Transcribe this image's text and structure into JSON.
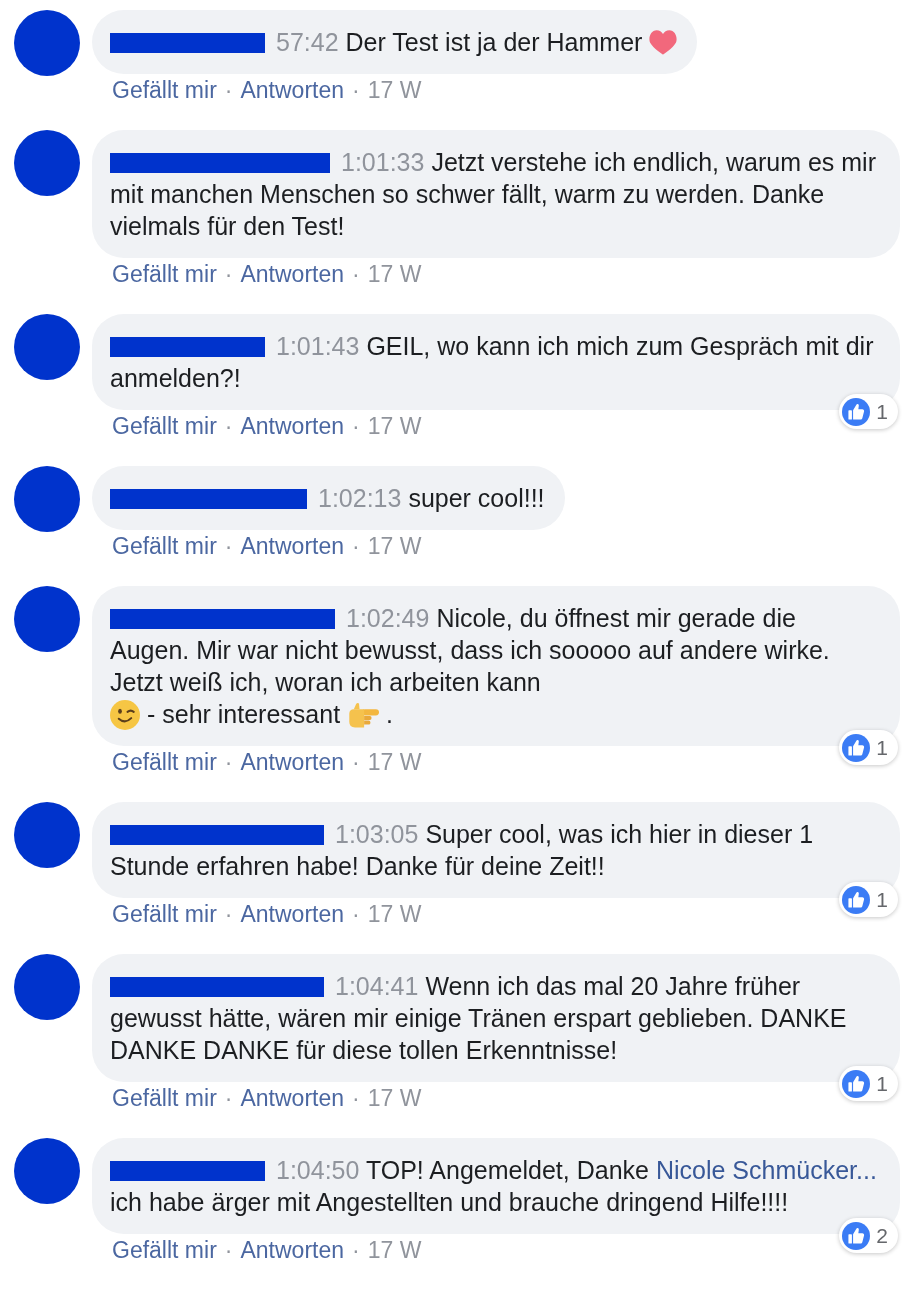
{
  "comments": [
    {
      "timestamp": "57:42",
      "message": [
        {
          "kind": "text",
          "text": "Der Test ist ja der Hammer"
        },
        {
          "kind": "heart"
        }
      ],
      "actions": [
        {
          "kind": "like",
          "text": "Gefällt mir"
        },
        {
          "kind": "dot",
          "text": "·"
        },
        {
          "kind": "reply",
          "text": "Antworten"
        },
        {
          "kind": "dot",
          "text": "·"
        },
        {
          "kind": "age",
          "text": "17 W"
        }
      ]
    },
    {
      "timestamp": "1:01:33",
      "message": [
        {
          "kind": "text",
          "text": "Jetzt verstehe ich endlich, warum es mir mit manchen Menschen so schwer fällt, warm zu werden. Danke vielmals für den Test!"
        }
      ],
      "actions": [
        {
          "kind": "like",
          "text": "Gefällt mir"
        },
        {
          "kind": "dot",
          "text": "·"
        },
        {
          "kind": "reply",
          "text": "Antworten"
        },
        {
          "kind": "dot",
          "text": "·"
        },
        {
          "kind": "age",
          "text": "17 W"
        }
      ]
    },
    {
      "timestamp": "1:01:43",
      "message": [
        {
          "kind": "text",
          "text": "GEIL, wo kann ich mich zum Gespräch mit dir anmelden?!"
        }
      ],
      "reaction_count": "1",
      "actions": [
        {
          "kind": "like",
          "text": "Gefällt mir"
        },
        {
          "kind": "dot",
          "text": "·"
        },
        {
          "kind": "reply",
          "text": "Antworten"
        },
        {
          "kind": "dot",
          "text": "·"
        },
        {
          "kind": "age",
          "text": "17 W"
        }
      ]
    },
    {
      "timestamp": "1:02:13",
      "message": [
        {
          "kind": "text",
          "text": "super cool!!!"
        }
      ],
      "actions": [
        {
          "kind": "like",
          "text": "Gefällt mir"
        },
        {
          "kind": "dot",
          "text": "·"
        },
        {
          "kind": "reply",
          "text": "Antworten"
        },
        {
          "kind": "dot",
          "text": "·"
        },
        {
          "kind": "age",
          "text": "17 W"
        }
      ]
    },
    {
      "timestamp": "1:02:49",
      "message": [
        {
          "kind": "text",
          "text": "Nicole, du öffnest mir gerade die Augen. Mir war nicht bewusst, dass ich sooooo auf andere wirke. Jetzt weiß ich, woran ich arbeiten kann\n"
        },
        {
          "kind": "wink"
        },
        {
          "kind": "text",
          "text": "- sehr interessant"
        },
        {
          "kind": "point"
        },
        {
          "kind": "text",
          "text": "."
        }
      ],
      "reaction_count": "1",
      "actions": [
        {
          "kind": "like",
          "text": "Gefällt mir"
        },
        {
          "kind": "dot",
          "text": "·"
        },
        {
          "kind": "reply",
          "text": "Antworten"
        },
        {
          "kind": "dot",
          "text": "·"
        },
        {
          "kind": "age",
          "text": "17 W"
        }
      ]
    },
    {
      "timestamp": "1:03:05",
      "message": [
        {
          "kind": "text",
          "text": "Super cool, was ich hier in dieser 1 Stunde erfahren habe! Danke für deine Zeit!!"
        }
      ],
      "reaction_count": "1",
      "actions": [
        {
          "kind": "like",
          "text": "Gefällt mir"
        },
        {
          "kind": "dot",
          "text": "·"
        },
        {
          "kind": "reply",
          "text": "Antworten"
        },
        {
          "kind": "dot",
          "text": "·"
        },
        {
          "kind": "age",
          "text": "17 W"
        }
      ]
    },
    {
      "timestamp": "1:04:41",
      "message": [
        {
          "kind": "text",
          "text": "Wenn ich das mal 20 Jahre früher gewusst hätte, wären mir einige Tränen erspart geblieben. DANKE DANKE DANKE für diese tollen Erkenntnisse!"
        }
      ],
      "reaction_count": "1",
      "actions": [
        {
          "kind": "like",
          "text": "Gefällt mir"
        },
        {
          "kind": "dot",
          "text": "·"
        },
        {
          "kind": "reply",
          "text": "Antworten"
        },
        {
          "kind": "dot",
          "text": "·"
        },
        {
          "kind": "age",
          "text": "17 W"
        }
      ]
    },
    {
      "timestamp": "1:04:50",
      "message": [
        {
          "kind": "text",
          "text": "TOP! Angemeldet, Danke"
        },
        {
          "kind": "mention",
          "text": "Nicole Schmücker..."
        },
        {
          "kind": "text",
          "text": "ich habe ärger mit Angestellten und brauche dringend Hilfe!!!!"
        }
      ],
      "reaction_count": "2",
      "actions": [
        {
          "kind": "like",
          "text": "Gefällt mir"
        },
        {
          "kind": "dot",
          "text": "·"
        },
        {
          "kind": "reply",
          "text": "Antworten"
        },
        {
          "kind": "dot",
          "text": "·"
        },
        {
          "kind": "age",
          "text": "17 W"
        }
      ]
    }
  ]
}
